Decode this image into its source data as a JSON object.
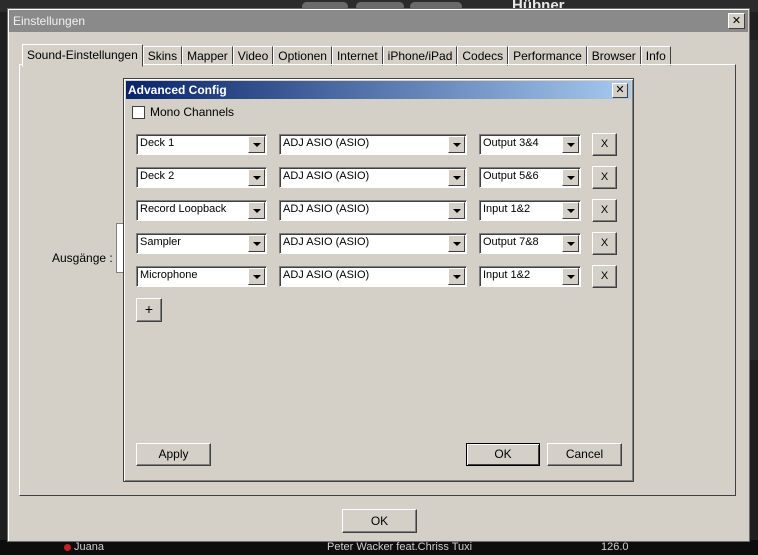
{
  "background_app": {
    "title": "Hübner",
    "bottom_track": "Peter Wacker feat.Chriss Tuxi",
    "bottom_left": "Juana",
    "bottom_bpm": "126.0"
  },
  "main_window": {
    "title": "Einstellungen",
    "close_glyph": "✕",
    "tabs": [
      {
        "label": "Sound-Einstellungen",
        "active": true
      },
      {
        "label": "Skins"
      },
      {
        "label": "Mapper"
      },
      {
        "label": "Video"
      },
      {
        "label": "Optionen"
      },
      {
        "label": "Internet"
      },
      {
        "label": "iPhone/iPad"
      },
      {
        "label": "Codecs"
      },
      {
        "label": "Performance"
      },
      {
        "label": "Browser"
      },
      {
        "label": "Info"
      }
    ],
    "outputs_label": "Ausgänge :",
    "ok_label": "OK"
  },
  "advanced_config": {
    "title": "Advanced Config",
    "close_glyph": "✕",
    "mono_channels_label": "Mono Channels",
    "mono_channels_checked": false,
    "rows": [
      {
        "channel": "Deck 1",
        "device": "ADJ ASIO (ASIO)",
        "output": "Output 3&4",
        "remove": "X"
      },
      {
        "channel": "Deck 2",
        "device": "ADJ ASIO (ASIO)",
        "output": "Output 5&6",
        "remove": "X"
      },
      {
        "channel": "Record Loopback",
        "device": "ADJ ASIO (ASIO)",
        "output": "Input 1&2",
        "remove": "X"
      },
      {
        "channel": "Sampler",
        "device": "ADJ ASIO (ASIO)",
        "output": "Output 7&8",
        "remove": "X"
      },
      {
        "channel": "Microphone",
        "device": "ADJ ASIO (ASIO)",
        "output": "Input 1&2",
        "remove": "X"
      }
    ],
    "add_label": "+",
    "apply_label": "Apply",
    "ok_label": "OK",
    "cancel_label": "Cancel"
  }
}
